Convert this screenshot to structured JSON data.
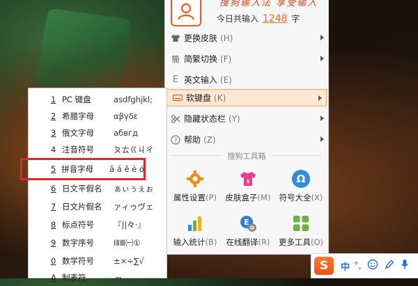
{
  "header": {
    "slogan": "搜狗输入法 享受输入",
    "count_prefix": "今日共输入",
    "count_value": "1248",
    "count_suffix": "字"
  },
  "menu": {
    "items": [
      {
        "label": "更换皮肤",
        "key": "(H)",
        "icon": "shirt-icon",
        "submenu": true
      },
      {
        "label": "简繁切换",
        "key": "(F)",
        "icon": "traditional-char-icon",
        "submenu": true
      },
      {
        "label": "英文输入",
        "key": "(E)",
        "icon": "english-e-icon",
        "submenu": false
      },
      {
        "label": "软键盘",
        "key": "(K)",
        "icon": "keyboard-icon",
        "submenu": true,
        "active": true
      },
      {
        "label": "隐藏状态栏",
        "key": "(Y)",
        "icon": "hide-statusbar-icon",
        "submenu": true
      },
      {
        "label": "帮助",
        "key": "(Z)",
        "icon": "help-icon",
        "submenu": true
      }
    ],
    "tools_title": "搜狗工具箱",
    "tools": [
      {
        "label": "属性设置",
        "key": "(P)",
        "icon": "gear-icon",
        "color": "#f58a1f"
      },
      {
        "label": "皮肤盒子",
        "key": "(M)",
        "icon": "tshirt-box-icon",
        "color": "#ea3d8b"
      },
      {
        "label": "符号大全",
        "key": "(X)",
        "icon": "omega-icon",
        "color": "#2f8ddc"
      },
      {
        "label": "输入统计",
        "key": "(B)",
        "icon": "bar-stats-icon",
        "color": "#f2b21b"
      },
      {
        "label": "在线翻译",
        "key": "(R)",
        "icon": "translate-icon",
        "color": "#2f7fd6"
      },
      {
        "label": "更多工具",
        "key": "(O)",
        "icon": "grid-tools-icon",
        "color": "#6db33f"
      }
    ]
  },
  "softkeyboard": {
    "items": [
      {
        "index": "1",
        "name": "PC 键盘",
        "sample": "asdfghjkl;"
      },
      {
        "index": "2",
        "name": "希腊字母",
        "sample": "αβγδε"
      },
      {
        "index": "3",
        "name": "俄文字母",
        "sample": "абвгд"
      },
      {
        "index": "4",
        "name": "注音符号",
        "sample": "ㄆㄊㄍㄐㄔ"
      },
      {
        "index": "5",
        "name": "拼音字母",
        "sample": "ā á ě è ó",
        "highlighted": true
      },
      {
        "index": "6",
        "name": "日文平假名",
        "sample": "ぁぃぅぇぉ"
      },
      {
        "index": "7",
        "name": "日文片假名",
        "sample": "ァィゥヴェ"
      },
      {
        "index": "8",
        "name": "标点符号",
        "sample": "『||々·』"
      },
      {
        "index": "9",
        "name": "数字序号",
        "sample": "ⅠⅡⅢ㈠①"
      },
      {
        "index": "0",
        "name": "数学符号",
        "sample": "±×÷∑√"
      },
      {
        "index": "A",
        "name": "制表符",
        "sample": "┌┐"
      }
    ]
  },
  "taskbar": {
    "logo": "S",
    "mode": "中",
    "punct": "°,",
    "icons": [
      "smiley-icon",
      "pen-icon",
      "mic-icon"
    ]
  }
}
